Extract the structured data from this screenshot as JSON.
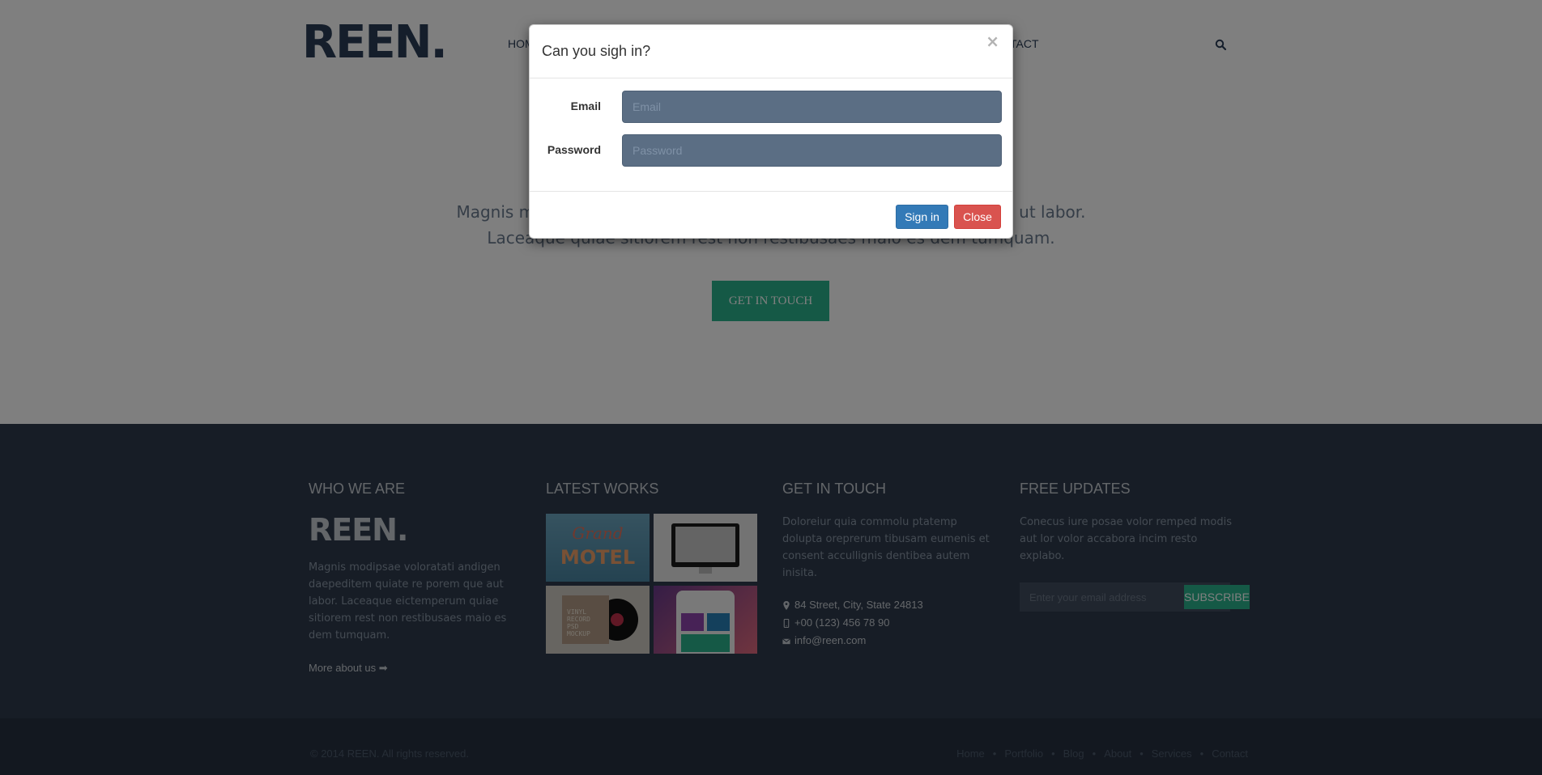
{
  "header": {
    "logo": "REEN.",
    "nav": [
      "HOM",
      "TACT"
    ]
  },
  "hero": {
    "line1_left": "Magnis m",
    "line1_right": "ut labor.",
    "line2": "Laceaque quiae sitiorem rest non restibusaes maio es dem tumquam.",
    "cta": "GET IN TOUCH"
  },
  "footer": {
    "who": {
      "title": "WHO WE ARE",
      "logo": "REEN.",
      "text": "Magnis modipsae voloratati andigen daepeditem quiate re porem que aut labor. Laceaque eictemperum quiae sitiorem rest non restibusaes maio es dem tumquam.",
      "more": "More about us"
    },
    "works": {
      "title": "LATEST WORKS",
      "thumb1_line1": "Grand",
      "thumb1_line2": "MOTEL",
      "thumb3_text": "VINYL RECORD PSD MOCKUP"
    },
    "touch": {
      "title": "GET IN TOUCH",
      "text": "Doloreiur quia commolu ptatemp dolupta oreprerum tibusam eumenis et consent accullignis dentibea autem inisita.",
      "address": "84 Street, City, State 24813",
      "phone": "+00 (123) 456 78 90",
      "email": "info@reen.com"
    },
    "updates": {
      "title": "FREE UPDATES",
      "text": "Conecus iure posae volor remped modis aut lor volor accabora incim resto explabo.",
      "placeholder": "Enter your email address",
      "button": "SUBSCRIBE"
    }
  },
  "bottom": {
    "copyright": "© 2014 REEN. All rights reserved.",
    "links": [
      "Home",
      "Portfolio",
      "Blog",
      "About",
      "Services",
      "Contact"
    ]
  },
  "modal": {
    "title": "Can you sigh in?",
    "close_glyph": "×",
    "email_label": "Email",
    "email_placeholder": "Email",
    "password_label": "Password",
    "password_placeholder": "Password",
    "signin": "Sign in",
    "close": "Close"
  },
  "colors": {
    "brand": "#2a3d57",
    "accent": "#2bb38c",
    "footer_bg": "#2f3b4c",
    "primary": "#337ab7",
    "danger": "#d9534f"
  }
}
